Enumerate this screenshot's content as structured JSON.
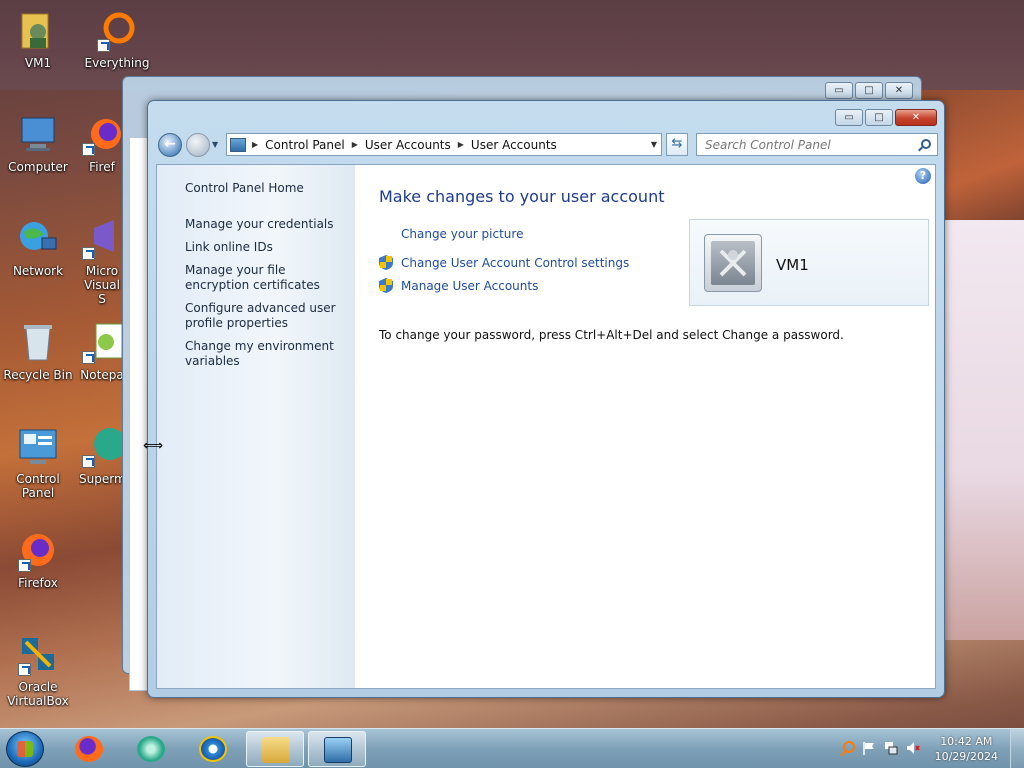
{
  "desktop": {
    "icons": [
      {
        "label": "VM1"
      },
      {
        "label": "Everything"
      },
      {
        "label": "Computer"
      },
      {
        "label": "Firef"
      },
      {
        "label": "Network"
      },
      {
        "label": "Micro Visual S"
      },
      {
        "label": "Recycle Bin"
      },
      {
        "label": "Notepa"
      },
      {
        "label": "Control Panel"
      },
      {
        "label": "Superm"
      },
      {
        "label": "Firefox"
      },
      {
        "label": "Oracle VirtualBox"
      }
    ]
  },
  "window": {
    "buttons": {
      "minimize": "▭",
      "maximize": "□",
      "close": "✕"
    },
    "breadcrumb": [
      "Control Panel",
      "User Accounts",
      "User Accounts"
    ],
    "search_placeholder": "Search Control Panel",
    "left_nav": {
      "home": "Control Panel Home",
      "items": [
        "Manage your credentials",
        "Link online IDs",
        "Manage your file encryption certificates",
        "Configure advanced user profile properties",
        "Change my environment variables"
      ]
    },
    "main": {
      "heading": "Make changes to your user account",
      "links": [
        "Change your picture",
        "Change User Account Control settings",
        "Manage User Accounts"
      ],
      "note": "To change your password, press Ctrl+Alt+Del and select Change a password.",
      "account_name": "VM1"
    }
  },
  "taskbar": {
    "clock_time": "10:42 AM",
    "clock_date": "10/29/2024"
  }
}
